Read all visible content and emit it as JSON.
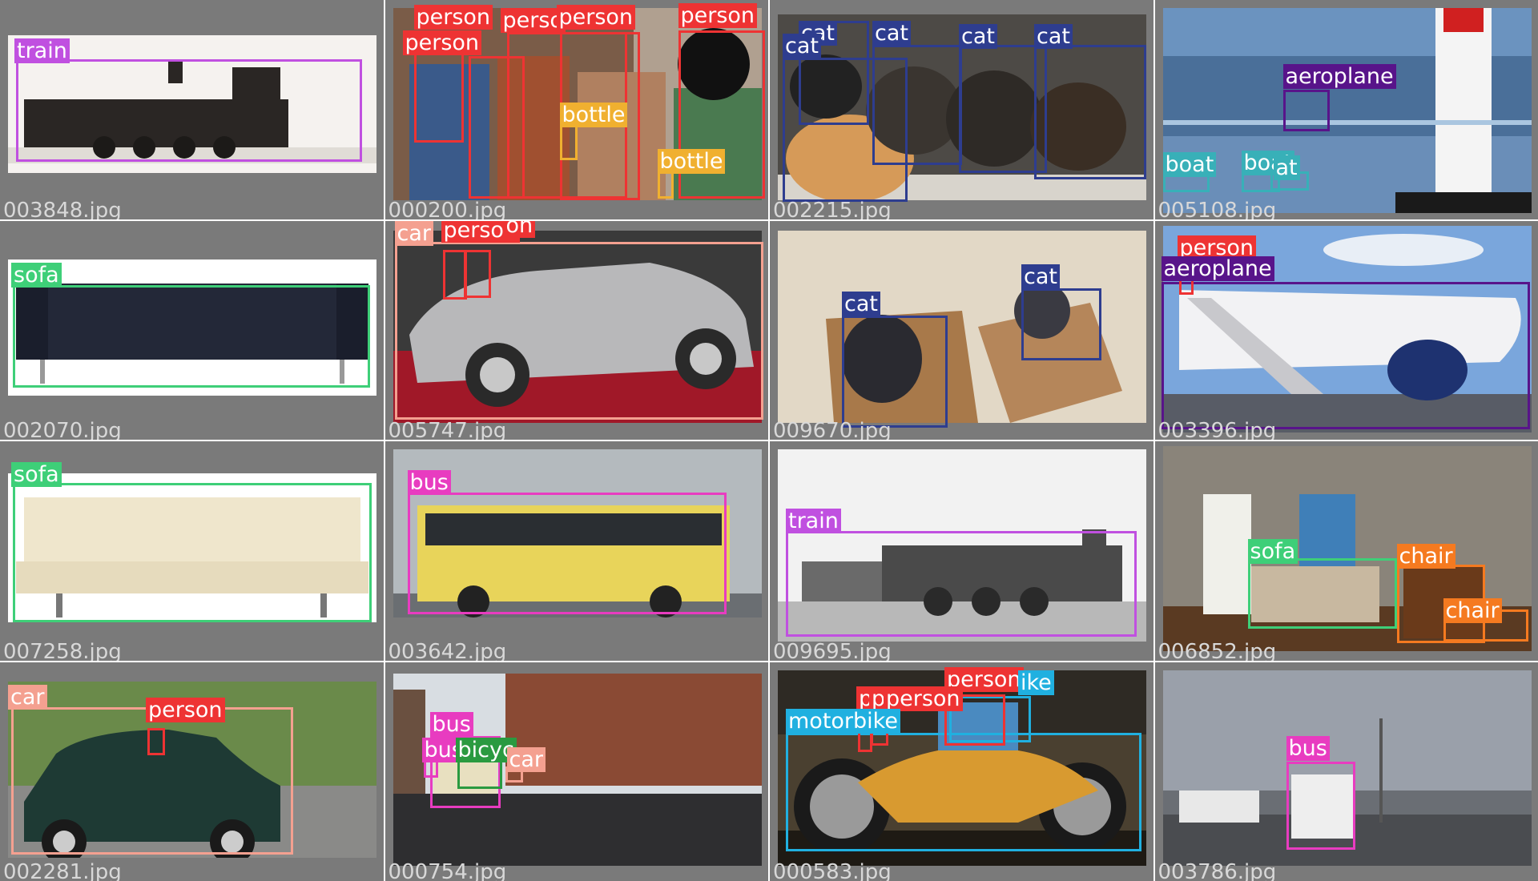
{
  "class_colors": {
    "train": "#c050e0",
    "person": "#ee3333",
    "bottle": "#f0b030",
    "cat": "#2e3d8f",
    "aeroplane": "#58148a",
    "boat": "#38b0b8",
    "sofa": "#3ecf78",
    "car": "#f4a090",
    "bus": "#e83cc0",
    "chair": "#f57a20",
    "bicycle": "#2a9a40",
    "motorbike": "#20b0e0"
  },
  "tiles": [
    {
      "file": "003848.jpg",
      "scene": "steam-locomotive-model",
      "bg": "#f4f1ee",
      "labels": [
        {
          "text": "train",
          "cls": "train"
        }
      ]
    },
    {
      "file": "000200.jpg",
      "scene": "party-people",
      "bg": "#6a4a3a",
      "labels": [
        {
          "text": "person",
          "cls": "person"
        },
        {
          "text": "person",
          "cls": "person"
        },
        {
          "text": "perso",
          "cls": "person"
        },
        {
          "text": "person",
          "cls": "person"
        },
        {
          "text": "person",
          "cls": "person"
        },
        {
          "text": "bottle",
          "cls": "bottle"
        },
        {
          "text": "bottle",
          "cls": "bottle"
        }
      ]
    },
    {
      "file": "002215.jpg",
      "scene": "cats-in-window",
      "bg": "#4d4a46",
      "labels": [
        {
          "text": "cat",
          "cls": "cat"
        },
        {
          "text": "cat",
          "cls": "cat"
        },
        {
          "text": "cat",
          "cls": "cat"
        },
        {
          "text": "cat",
          "cls": "cat"
        },
        {
          "text": "cat",
          "cls": "cat"
        }
      ]
    },
    {
      "file": "005108.jpg",
      "scene": "harbor-lighthouse-plane",
      "bg": "#5a84b0",
      "labels": [
        {
          "text": "aeroplane",
          "cls": "aeroplane"
        },
        {
          "text": "boat",
          "cls": "boat"
        },
        {
          "text": "boat",
          "cls": "boat"
        },
        {
          "text": "at",
          "cls": "boat"
        }
      ]
    },
    {
      "file": "002070.jpg",
      "scene": "dark-sofa",
      "bg": "#ffffff",
      "labels": [
        {
          "text": "sofa",
          "cls": "sofa"
        }
      ]
    },
    {
      "file": "005747.jpg",
      "scene": "silver-car-show",
      "bg": "#3a3a3a",
      "labels": [
        {
          "text": "car",
          "cls": "car"
        },
        {
          "text": "person",
          "cls": "person"
        },
        {
          "text": "on",
          "cls": "person"
        }
      ]
    },
    {
      "file": "009670.jpg",
      "scene": "cats-in-boxes",
      "bg": "#d8ccb8",
      "labels": [
        {
          "text": "cat",
          "cls": "cat"
        },
        {
          "text": "cat",
          "cls": "cat"
        }
      ]
    },
    {
      "file": "003396.jpg",
      "scene": "airliner-stairs",
      "bg": "#7aa6dc",
      "labels": [
        {
          "text": "person",
          "cls": "person"
        },
        {
          "text": "aeroplane",
          "cls": "aeroplane"
        }
      ]
    },
    {
      "file": "007258.jpg",
      "scene": "cream-sofa",
      "bg": "#ffffff",
      "labels": [
        {
          "text": "sofa",
          "cls": "sofa"
        }
      ]
    },
    {
      "file": "003642.jpg",
      "scene": "yellow-bus",
      "bg": "#a8aeb2",
      "labels": [
        {
          "text": "bus",
          "cls": "bus"
        }
      ]
    },
    {
      "file": "009695.jpg",
      "scene": "bw-locomotive",
      "bg": "#f2f2f2",
      "labels": [
        {
          "text": "train",
          "cls": "train"
        }
      ]
    },
    {
      "file": "006852.jpg",
      "scene": "living-room",
      "bg": "#6e6a62",
      "labels": [
        {
          "text": "sofa",
          "cls": "sofa"
        },
        {
          "text": "chair",
          "cls": "chair"
        },
        {
          "text": "chair",
          "cls": "chair"
        }
      ]
    },
    {
      "file": "002281.jpg",
      "scene": "green-mini",
      "bg": "#6a8a4a",
      "labels": [
        {
          "text": "car",
          "cls": "car"
        },
        {
          "text": "person",
          "cls": "person"
        }
      ]
    },
    {
      "file": "000754.jpg",
      "scene": "street-buses",
      "bg": "#6e5a4e",
      "labels": [
        {
          "text": "bus",
          "cls": "bus"
        },
        {
          "text": "bus",
          "cls": "bus"
        },
        {
          "text": "bicyc",
          "cls": "bicycle"
        },
        {
          "text": "car",
          "cls": "car"
        }
      ]
    },
    {
      "file": "000583.jpg",
      "scene": "gold-motorbike",
      "bg": "#3a3020",
      "labels": [
        {
          "text": "person",
          "cls": "person"
        },
        {
          "text": "ike",
          "cls": "motorbike"
        },
        {
          "text": "pe",
          "cls": "person"
        },
        {
          "text": "p",
          "cls": "person"
        },
        {
          "text": "person",
          "cls": "person"
        },
        {
          "text": "motorbike",
          "cls": "motorbike"
        }
      ]
    },
    {
      "file": "003786.jpg",
      "scene": "coach-bus-dusk",
      "bg": "#8a8e96",
      "labels": [
        {
          "text": "bus",
          "cls": "bus"
        }
      ]
    }
  ]
}
